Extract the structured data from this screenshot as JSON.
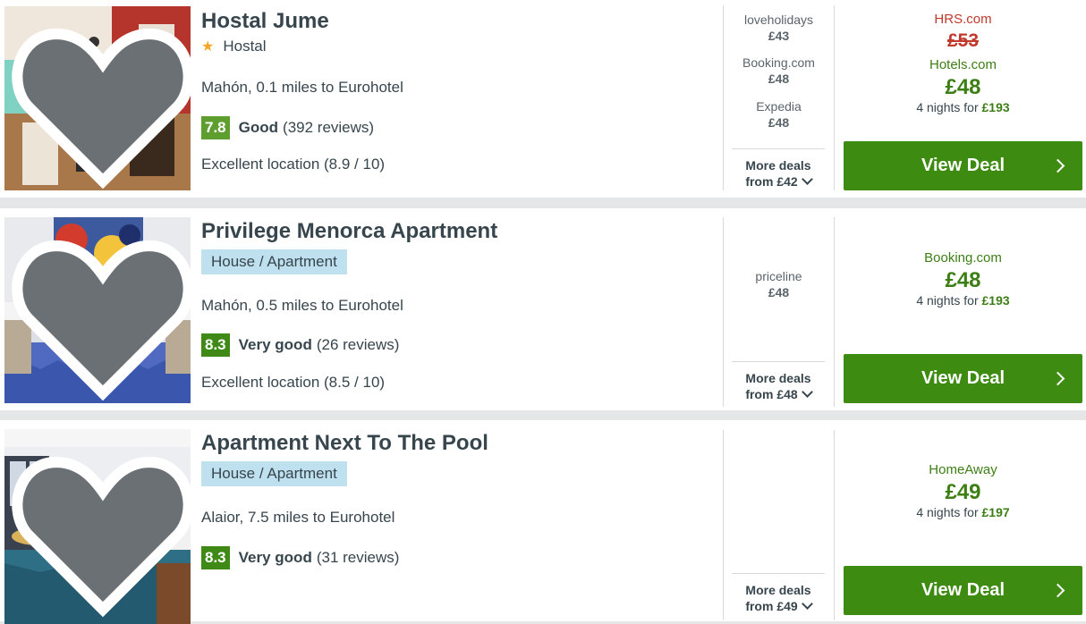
{
  "colors": {
    "accent_green": "#3d8b10",
    "price_green": "#3d7e15",
    "strike_red": "#c0392b",
    "badge_blue": "#bfe0ee"
  },
  "results": [
    {
      "name": "Hostal Jume",
      "stars_icon": "star-icon",
      "category": "Hostal",
      "location": "Mahón, 0.1 miles to Eurohotel",
      "score": "7.8",
      "rating_word": "Good",
      "reviews": "(392 reviews)",
      "location_score": "Excellent location (8.9 / 10)",
      "other_deals": [
        {
          "provider": "loveholidays",
          "price": "£43"
        },
        {
          "provider": "Booking.com",
          "price": "£48"
        },
        {
          "provider": "Expedia",
          "price": "£48"
        }
      ],
      "more_deals_line1": "More deals",
      "more_deals_line2": "from £42",
      "strike_provider": "HRS.com",
      "strike_price": "£53",
      "best_provider": "Hotels.com",
      "best_price": "£48",
      "nights_text": "4 nights for",
      "nights_total": "£193",
      "button_label": "View Deal"
    },
    {
      "name": "Privilege Menorca Apartment",
      "category": "House / Apartment",
      "location": "Mahón, 0.5 miles to Eurohotel",
      "score": "8.3",
      "rating_word": "Very good",
      "reviews": "(26 reviews)",
      "location_score": "Excellent location (8.5 / 10)",
      "other_deals": [
        {
          "provider": "priceline",
          "price": "£48"
        }
      ],
      "more_deals_line1": "More deals",
      "more_deals_line2": "from £48",
      "best_provider": "Booking.com",
      "best_price": "£48",
      "nights_text": "4 nights for",
      "nights_total": "£193",
      "button_label": "View Deal"
    },
    {
      "name": "Apartment Next To The Pool",
      "category": "House / Apartment",
      "location": "Alaior, 7.5 miles to Eurohotel",
      "score": "8.3",
      "rating_word": "Very good",
      "reviews": "(31 reviews)",
      "more_deals_line1": "More deals",
      "more_deals_line2": "from £49",
      "best_provider": "HomeAway",
      "best_price": "£49",
      "nights_text": "4 nights for",
      "nights_total": "£197",
      "button_label": "View Deal"
    }
  ]
}
